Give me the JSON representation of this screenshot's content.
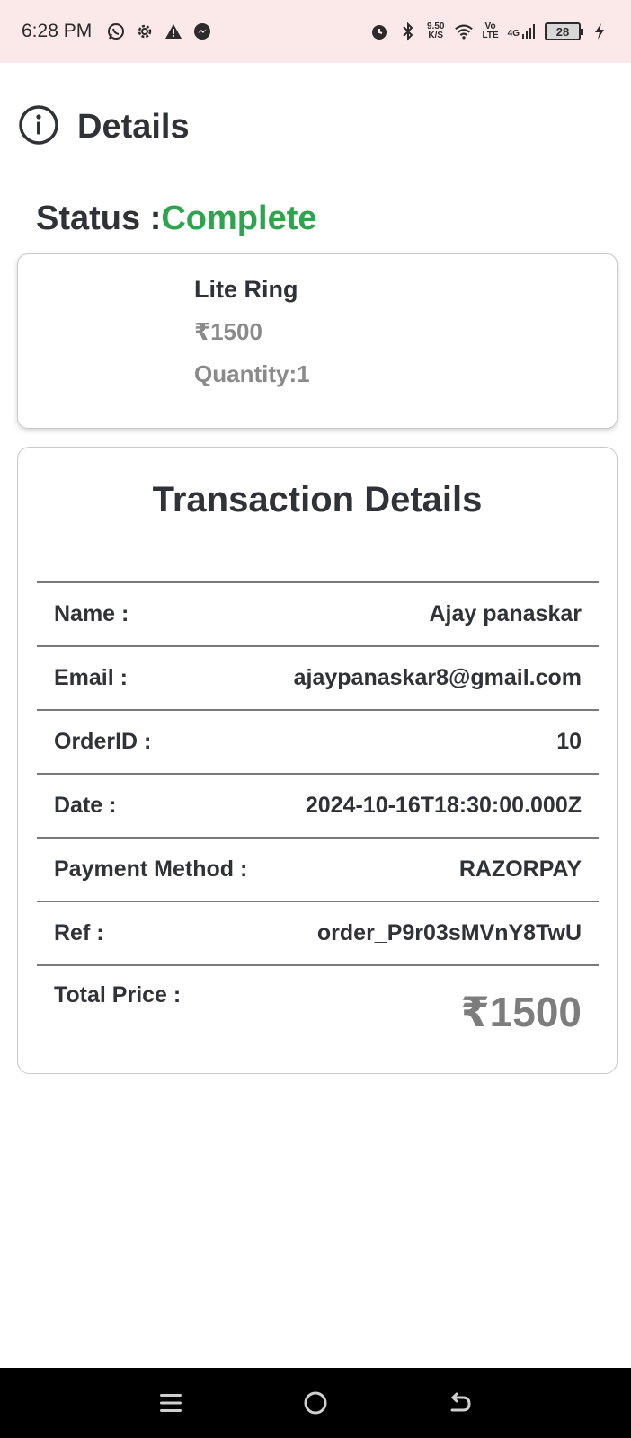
{
  "status_bar": {
    "time": "6:28 PM",
    "network_speed": "9.50",
    "network_unit": "K/S",
    "volte": "Vo",
    "lte": "LTE",
    "signal": "4G",
    "battery": "28",
    "icons": [
      "whatsapp-icon",
      "gear-icon",
      "warning-icon",
      "messenger-icon",
      "alarm-icon",
      "bluetooth-icon",
      "wifi-icon",
      "signal-icon",
      "charging-icon"
    ]
  },
  "header": {
    "title": "Details",
    "icon": "info-icon"
  },
  "order_status": {
    "label": "Status :",
    "value": "Complete",
    "value_color": "#2ea44f"
  },
  "product": {
    "name": "Lite Ring",
    "price": "₹1500",
    "quantity": "Quantity:1"
  },
  "transaction": {
    "title": "Transaction Details",
    "rows": [
      {
        "label": "Name :",
        "value": "Ajay panaskar"
      },
      {
        "label": "Email :",
        "value": "ajaypanaskar8@gmail.com"
      },
      {
        "label": "OrderID :",
        "value": "10"
      },
      {
        "label": "Date :",
        "value": "2024-10-16T18:30:00.000Z"
      },
      {
        "label": "Payment Method :",
        "value": "RAZORPAY"
      },
      {
        "label": "Ref :",
        "value": "order_P9r03sMVnY8TwU"
      }
    ],
    "total_label": "Total Price :",
    "total_value": "₹1500"
  },
  "nav_bar": {
    "buttons": [
      "menu-icon",
      "home-icon",
      "back-icon"
    ]
  }
}
